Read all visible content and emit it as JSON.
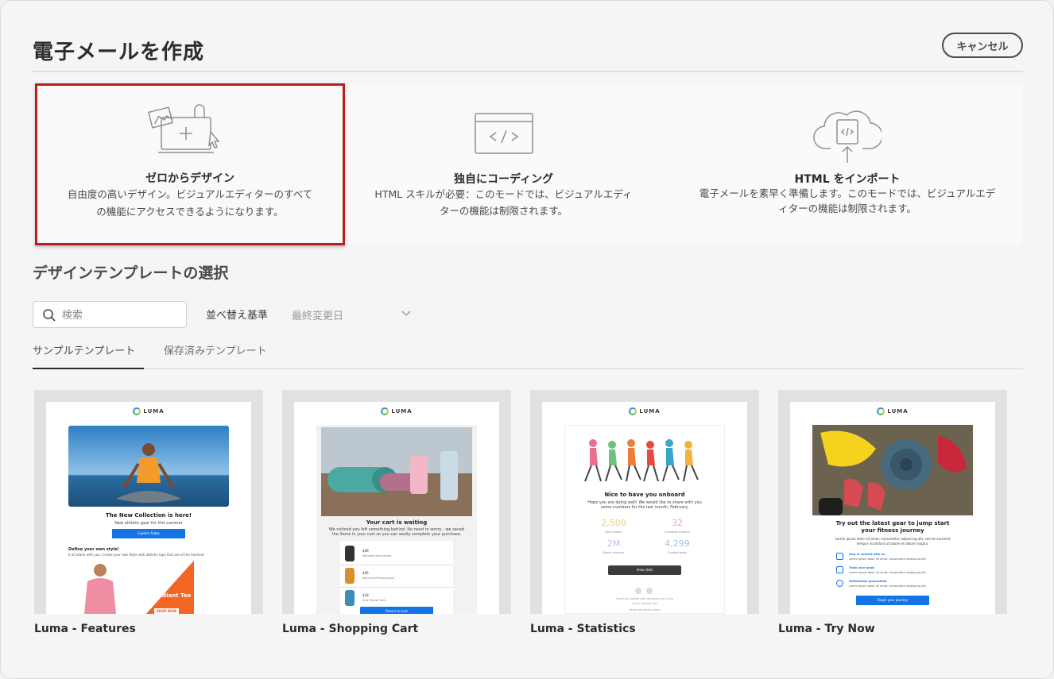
{
  "header": {
    "title": "電子メールを作成",
    "cancel_label": "キャンセル"
  },
  "modes": [
    {
      "title": "ゼロからデザイン",
      "desc_line1": "自由度の高いデザイン。ビジュアルエディターのすべて",
      "desc_line2": "の機能にアクセスできるようになります。"
    },
    {
      "title": "独自にコーディング",
      "desc_line1": "HTML スキルが必要：このモードでは、ビジュアルエディ",
      "desc_line2": "ターの機能は制限されます。"
    },
    {
      "title": "HTML をインポート",
      "desc_line1": "電子メールを素早く準備します。このモードでは、ビジュアルエデ",
      "desc_line2": "ィターの機能は制限されます。"
    }
  ],
  "templates_section": {
    "title": "デザインテンプレートの選択",
    "search_placeholder": "検索",
    "sort_label": "並べ替え基準",
    "sort_value": "最終変更日",
    "tabs": [
      "サンプルテンプレート",
      "保存済みテンプレート"
    ]
  },
  "templates": [
    {
      "name": "Luma - Features",
      "brand": "LUMA",
      "headline": "The New Collection is here!",
      "sub": "New athletic gear for this summer",
      "button": "Explore Today",
      "section": "Define your own style!",
      "section_text": "It all starts with you. Create your own Style with athletic tops that are of the moment",
      "promo_new": "NEW",
      "promo_name": "Radiant Tee",
      "promo_button": "SHOP NOW"
    },
    {
      "name": "Luma - Shopping Cart",
      "brand": "LUMA",
      "headline": "Your cart is waiting",
      "sub": "We noticed you left something behind. No need to worry - we saved the items in your cart so you can easily complete your purchase.",
      "items": [
        {
          "price": "$49",
          "name": "Womens Wind Jacket"
        },
        {
          "price": "$45",
          "name": "Womens Fitness Jacket"
        },
        {
          "price": "$18",
          "name": "Aria Fitness Tank"
        }
      ],
      "button": "Return to cart"
    },
    {
      "name": "Luma - Statistics",
      "brand": "LUMA",
      "headline": "Nice to have you onboard",
      "sub": "Hope you are doing well! We would like to share with you some numbers for the last month, February.",
      "stats": [
        {
          "value": "2,500",
          "label": "New visitors"
        },
        {
          "value": "32",
          "label": "Complete projects"
        },
        {
          "value": "2M",
          "label": "Month revenue"
        },
        {
          "value": "4,299",
          "label": "Created tasks"
        }
      ],
      "button": "View stats",
      "footer_line1": "Carefully crafted with dynamics by Luma",
      "footer_line2": "Luma, Boston, MA",
      "footer_line3": "Read this email online"
    },
    {
      "name": "Luma - Try Now",
      "brand": "LUMA",
      "headline": "Try out the latest gear to jump start your fitness journey",
      "sub": "Lorem ipsum dolor sit amet, consectetur adipiscing elit, sed do eiusmod tempor incididunt ut labore et dolore magna.",
      "features": [
        {
          "title": "Stay in contact with us",
          "text": "Lorem ipsum dolor sit amet, consectetur adipiscing elit."
        },
        {
          "title": "Track your goals",
          "text": "Lorem ipsum dolor sit amet, consectetur adipiscing elit."
        },
        {
          "title": "Satisfaction guaranteed",
          "text": "Lorem ipsum dolor sit amet, consectetur adipiscing elit."
        }
      ],
      "button": "Begin your journey"
    }
  ],
  "colors": {
    "selected_border": "#b4211e",
    "primary_button": "#1473e6",
    "stat_orange": "#f7c873",
    "stat_pink": "#f3a3b4",
    "stat_purple": "#c9b6f2",
    "stat_blue": "#9cc4ec"
  }
}
